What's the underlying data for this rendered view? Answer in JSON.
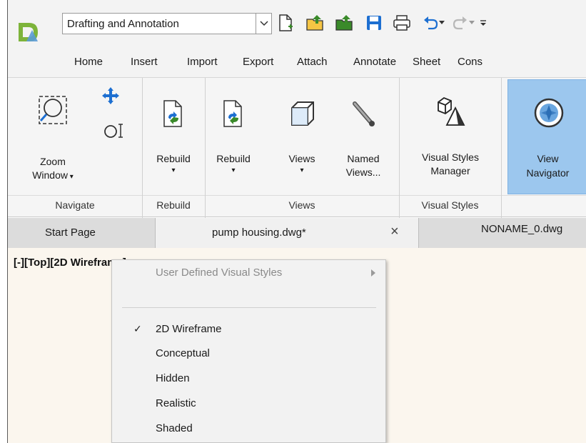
{
  "workspace": {
    "selected": "Drafting and Annotation"
  },
  "ribbon_tabs": [
    "Home",
    "Insert",
    "Import",
    "Export",
    "Attach",
    "Annotate",
    "Sheet",
    "Cons"
  ],
  "navigate": {
    "zoom_window_label": "Zoom",
    "zoom_window_label2": "Window",
    "panel_title": "Navigate"
  },
  "rebuild_panel": {
    "rebuild_label": "Rebuild",
    "panel_title": "Rebuild"
  },
  "views_panel": {
    "rebuild_label": "Rebuild",
    "views_label": "Views",
    "named_label": "Named",
    "named_label2": "Views...",
    "panel_title": "Views"
  },
  "visual_styles_panel": {
    "manager_label": "Visual Styles",
    "manager_label2": "Manager",
    "panel_title": "Visual Styles"
  },
  "view_nav": {
    "label": "View",
    "label2": "Navigator"
  },
  "doc_tabs": {
    "start": "Start Page",
    "active": "pump housing.dwg*",
    "close_glyph": "×",
    "next": "NONAME_0.dwg"
  },
  "viewport": {
    "label": "[-][Top][2D Wireframe]"
  },
  "context_menu": {
    "header": "User Defined Visual Styles",
    "items": [
      {
        "label": "2D Wireframe",
        "checked": true
      },
      {
        "label": "Conceptual",
        "checked": false
      },
      {
        "label": "Hidden",
        "checked": false
      },
      {
        "label": "Realistic",
        "checked": false
      },
      {
        "label": "Shaded",
        "checked": false
      }
    ],
    "check_glyph": "✓"
  },
  "colors": {
    "accent": "#9cc7ee",
    "canvas": "#fbf6ee",
    "logo_green": "#7db33a"
  }
}
